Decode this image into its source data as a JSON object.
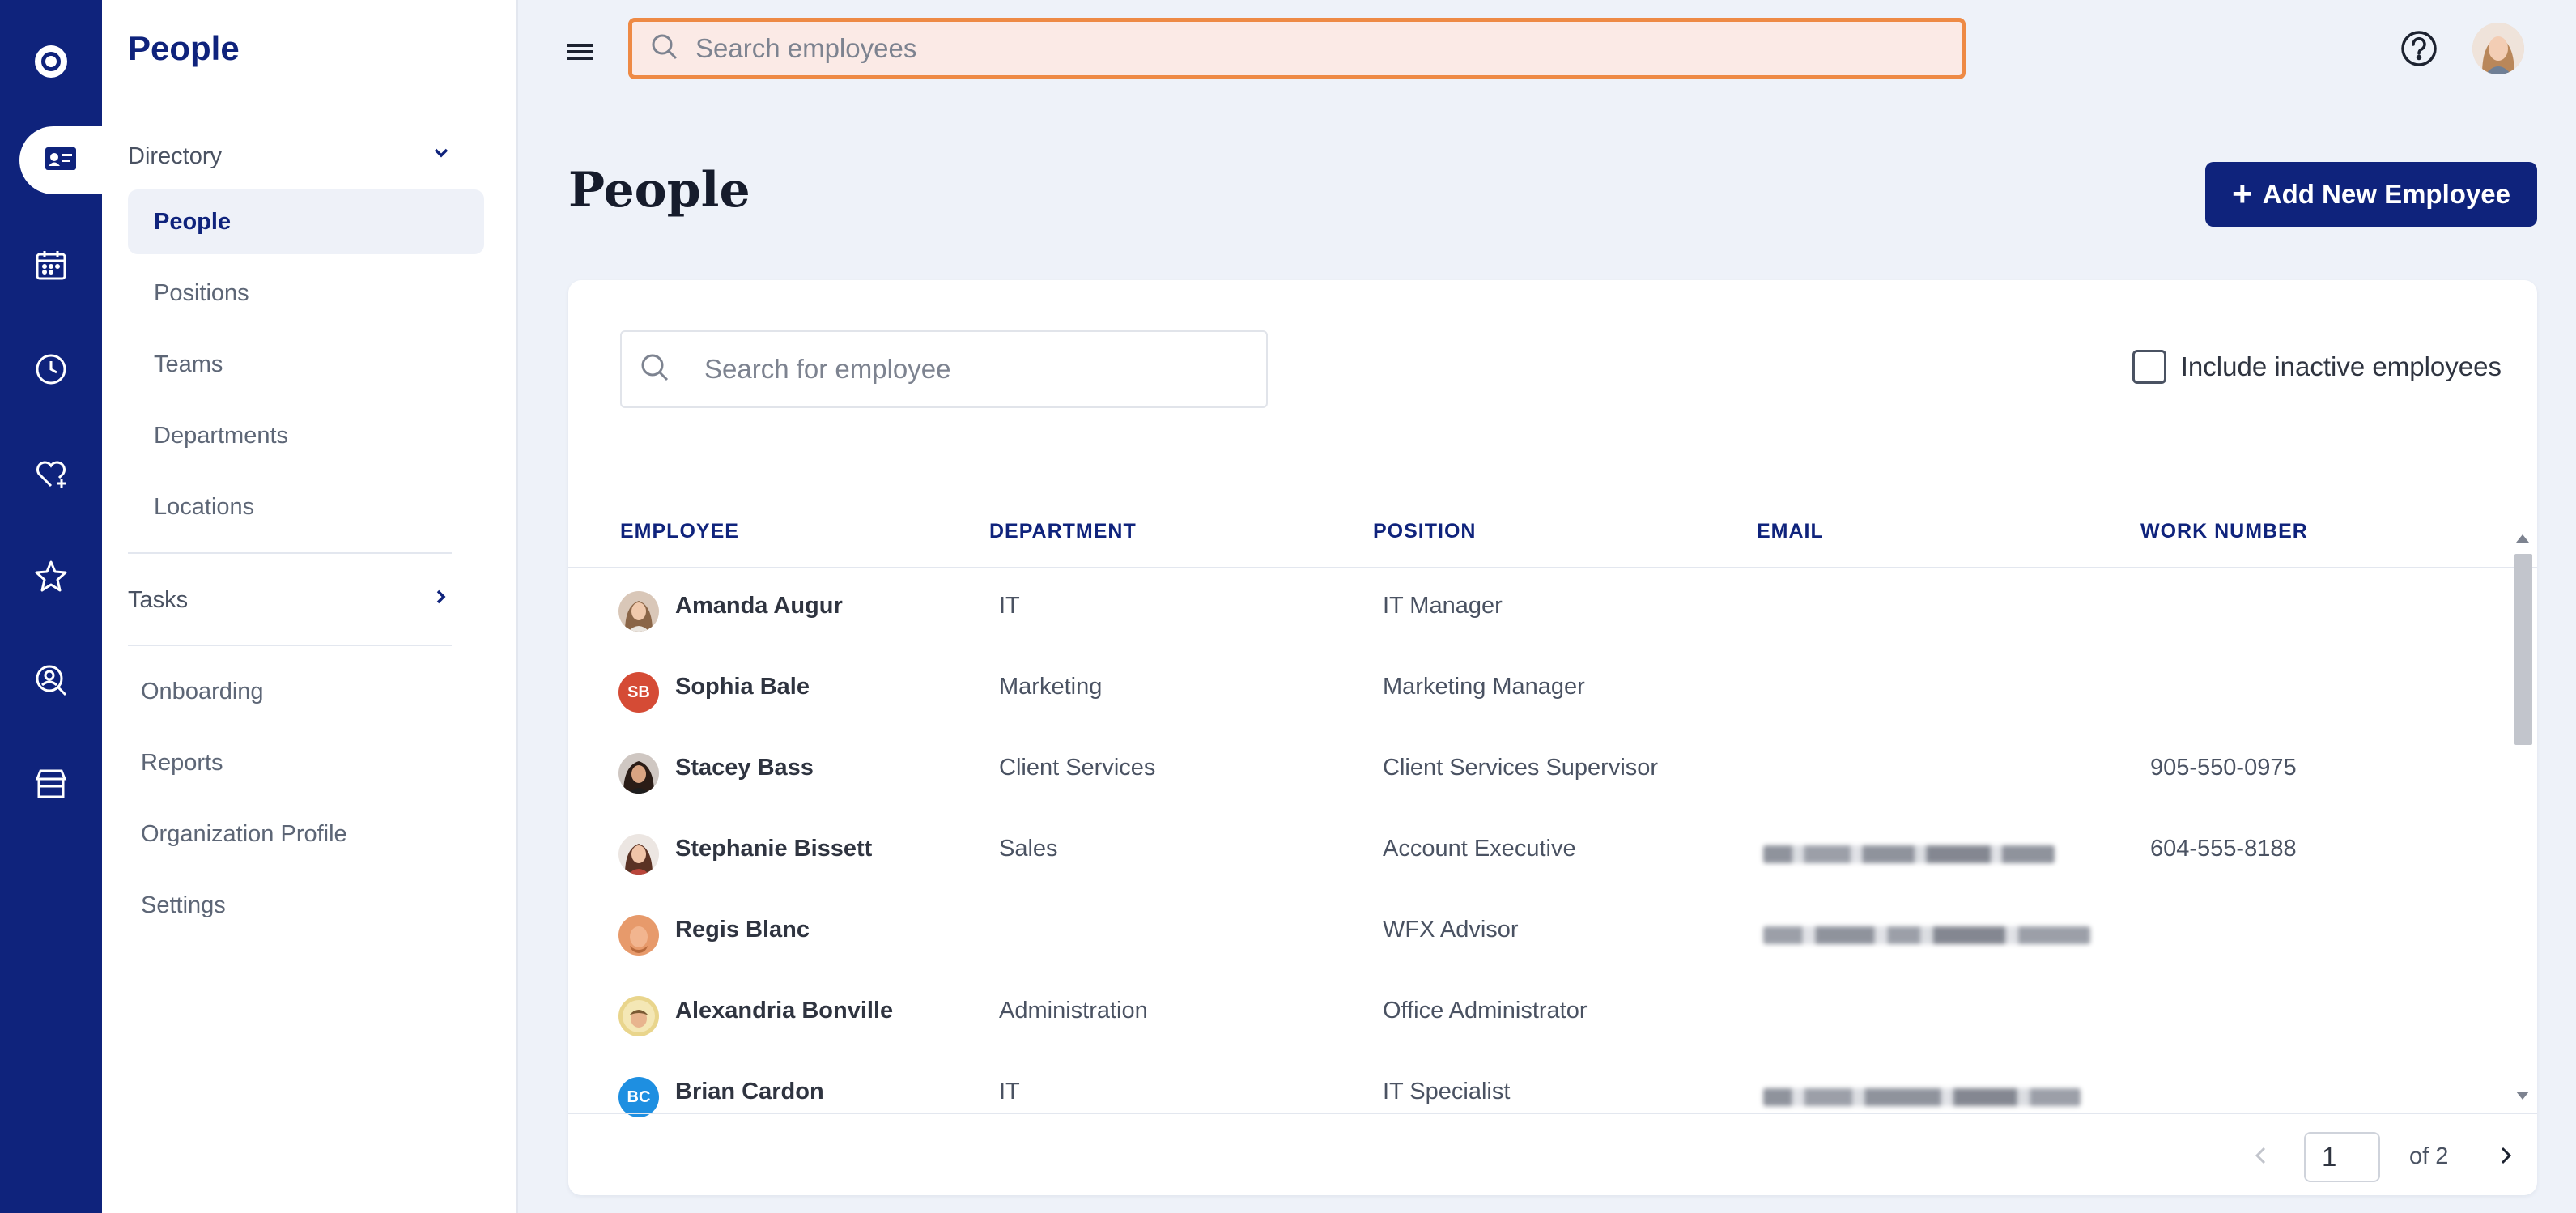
{
  "topbar": {
    "search_placeholder": "Search employees"
  },
  "rail": {
    "items": [
      {
        "icon": "app-logo-icon"
      },
      {
        "icon": "id-card-icon",
        "active": true
      },
      {
        "icon": "calendar-icon"
      },
      {
        "icon": "clock-icon"
      },
      {
        "icon": "heart-plus-icon"
      },
      {
        "icon": "star-icon"
      },
      {
        "icon": "person-search-icon"
      },
      {
        "icon": "store-icon"
      }
    ]
  },
  "sidebar": {
    "title": "People",
    "directory_label": "Directory",
    "directory_items": [
      "People",
      "Positions",
      "Teams",
      "Departments",
      "Locations"
    ],
    "tasks_label": "Tasks",
    "other_items": [
      "Onboarding",
      "Reports",
      "Organization Profile",
      "Settings"
    ]
  },
  "page": {
    "title": "People",
    "add_button_label": "Add New Employee",
    "add_button_plus": "+"
  },
  "table": {
    "search_placeholder": "Search for employee",
    "include_inactive_label": "Include inactive employees",
    "columns": [
      "EMPLOYEE",
      "DEPARTMENT",
      "POSITION",
      "EMAIL",
      "WORK NUMBER"
    ],
    "rows": [
      {
        "name": "Amanda Augur",
        "department": "IT",
        "position": "IT Manager",
        "email_redacted": false,
        "work_number": "",
        "avatar": "photo"
      },
      {
        "name": "Sophia Bale",
        "department": "Marketing",
        "position": "Marketing Manager",
        "email_redacted": false,
        "work_number": "",
        "avatar": "initials",
        "initials": "SB",
        "avatar_color": "#d54b35"
      },
      {
        "name": "Stacey Bass",
        "department": "Client Services",
        "position": "Client Services Supervisor",
        "email_redacted": false,
        "work_number": "905-550-0975",
        "avatar": "photo"
      },
      {
        "name": "Stephanie Bissett",
        "department": "Sales",
        "position": "Account Executive",
        "email_redacted": true,
        "work_number": "604-555-8188",
        "avatar": "photo"
      },
      {
        "name": "Regis Blanc",
        "department": "",
        "position": "WFX Advisor",
        "email_redacted": true,
        "work_number": "",
        "avatar": "photo"
      },
      {
        "name": "Alexandria Bonville",
        "department": "Administration",
        "position": "Office Administrator",
        "email_redacted": false,
        "work_number": "",
        "avatar": "photo"
      },
      {
        "name": "Brian Cardon",
        "department": "IT",
        "position": "IT Specialist",
        "email_redacted": true,
        "work_number": "",
        "avatar": "initials",
        "initials": "BC",
        "avatar_color": "#1e8fe1"
      }
    ]
  },
  "pagination": {
    "current_page": "1",
    "of_label": "of 2"
  },
  "colors": {
    "brand_navy": "#0f237c",
    "search_focus_border": "#ee8a45",
    "page_background": "#eef2f9"
  }
}
